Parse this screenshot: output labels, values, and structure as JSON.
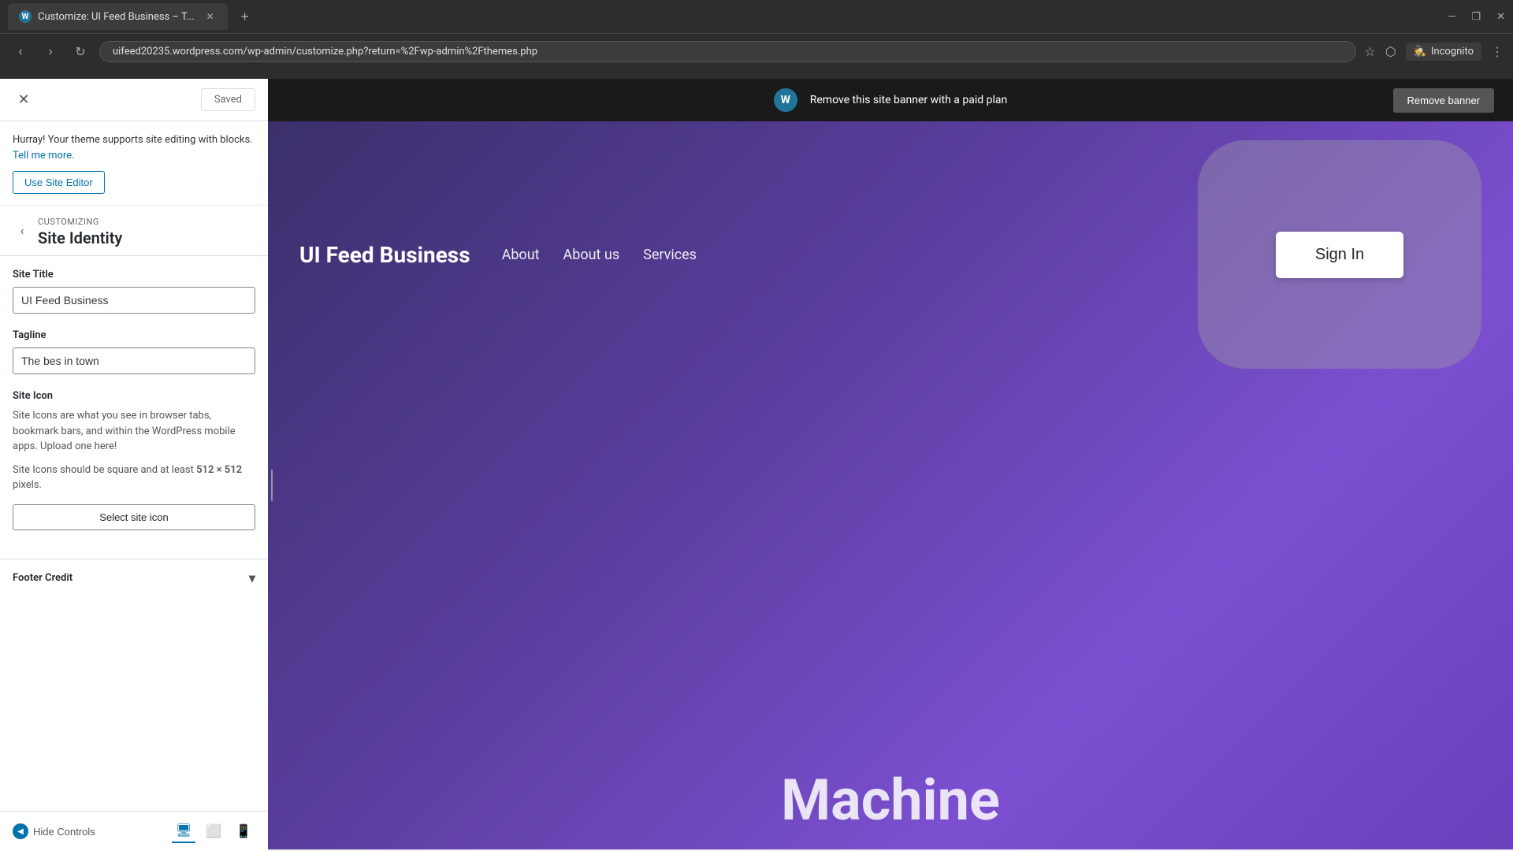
{
  "browser": {
    "tab_title": "Customize: UI Feed Business – T...",
    "url": "uifeed20235.wordpress.com/wp-admin/customize.php?return=%2Fwp-admin%2Fthemes.php",
    "incognito_label": "Incognito",
    "new_tab_icon": "+",
    "back_icon": "‹",
    "forward_icon": "›",
    "reload_icon": "↻",
    "menu_icon": "⋮",
    "star_icon": "☆",
    "window_min": "—",
    "window_max": "❐",
    "window_close": "✕"
  },
  "customizer": {
    "close_icon": "✕",
    "saved_label": "Saved",
    "block_support_text": "Hurray! Your theme supports site editing with blocks.",
    "tell_more_link": "Tell me more.",
    "use_site_editor_label": "Use Site Editor",
    "back_icon": "‹",
    "customizing_label": "Customizing",
    "section_title": "Site Identity",
    "site_title_label": "Site Title",
    "site_title_value": "UI Feed Business",
    "tagline_label": "Tagline",
    "tagline_value": "The bes in town",
    "site_icon_label": "Site Icon",
    "site_icon_description": "Site Icons are what you see in browser tabs, bookmark bars, and within the WordPress mobile apps. Upload one here!",
    "site_icon_requirement": "Site Icons should be square and at least 512 × 512 pixels.",
    "site_icon_size": "512",
    "select_icon_label": "Select site icon",
    "footer_credit_label": "Footer Credit",
    "hide_controls_label": "Hide Controls"
  },
  "wp_banner": {
    "text": "Remove this site banner with a paid plan",
    "button_label": "Remove banner",
    "wp_logo": "W"
  },
  "site_preview": {
    "site_title": "UI Feed Business",
    "nav_links": [
      "About",
      "About us",
      "Services"
    ],
    "sign_in_label": "Sign In",
    "machine_text": "Machine"
  },
  "icons": {
    "wp_tab": "W",
    "desktop": "🖥",
    "tablet": "⬜",
    "mobile": "📱",
    "chevron_down": "▾"
  }
}
